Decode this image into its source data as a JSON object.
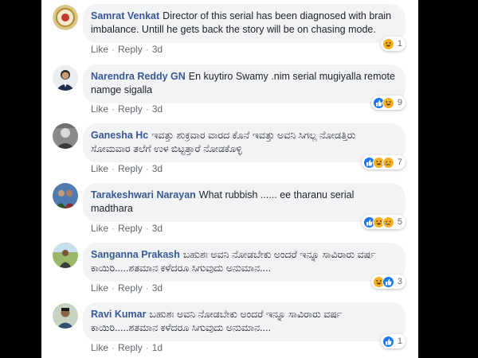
{
  "comments": [
    {
      "name": "Samrat Venkat",
      "text": "Director of this serial has been diagnosed with brain imbalance. Untill he gets back the story will be on chasing mode.",
      "like": "Like",
      "reply": "Reply",
      "time": "3d",
      "reactions": [
        "haha"
      ],
      "count": "1"
    },
    {
      "name": "Narendra Reddy GN",
      "text": "En kuytiro Swamy .nim serial mugiyalla remote namge sigalla",
      "like": "Like",
      "reply": "Reply",
      "time": "3d",
      "reactions": [
        "like",
        "haha"
      ],
      "count": "9"
    },
    {
      "name": "Ganesha Hc",
      "text": "ಇವತ್ತು ಶುಕ್ರವಾರ ವಾರದ ಕೊನೆ ಇವತ್ತು ಅವನಿ ಸಿಗಲ್ಲ ನೋಡತ್ತಿರು ಸೋಮವಾರ ತಲೆಗೆ ಉಳ ಬಿಟ್ಟತ್ತಾರೆ ನೋಡಕೊಳ್ಳಿ",
      "like": "Like",
      "reply": "Reply",
      "time": "3d",
      "reactions": [
        "like",
        "haha",
        "sad"
      ],
      "count": "7"
    },
    {
      "name": "Tarakeshwari Narayan",
      "text": "What rubbish ...... ee tharanu serial madthara",
      "like": "Like",
      "reply": "Reply",
      "time": "3d",
      "reactions": [
        "like",
        "haha",
        "sad"
      ],
      "count": "5"
    },
    {
      "name": "Sanganna Prakash",
      "text": "ಬಹುಶಃ ಅವನಿ ನೋಡಬೇಕು ಅಂದರೆ ಇನ್ನೂ ಸಾವಿರಾರು ವರ್ಷ ಕಾಯಿರಿ.....ಶತಮಾನ ಕಳೆದರೂ ಸಿಗುವುದು ಅನುಮಾನ....",
      "like": "Like",
      "reply": "Reply",
      "time": "3d",
      "reactions": [
        "haha",
        "like"
      ],
      "count": "3"
    },
    {
      "name": "Ravi Kumar",
      "text": "ಬಹುಶಃ ಅವನಿ ನೋಡಬೇಕು ಅಂದರೆ ಇನ್ನೂ ಸಾವಿರಾರು ವರ್ಷ ಕಾಯಿರಿ.....ಶತಮಾನ ಕಳೆದರೂ ಸಿಗುವುದು ಅನುಮಾನ....",
      "like": "Like",
      "reply": "Reply",
      "time": "1d",
      "reactions": [
        "like"
      ],
      "count": "1"
    }
  ],
  "colors": {
    "name": "#385898",
    "bubble": "#f2f3f5",
    "meta": "#606770",
    "like_reaction": "#1877f2",
    "haha_reaction": "#f7b125"
  }
}
